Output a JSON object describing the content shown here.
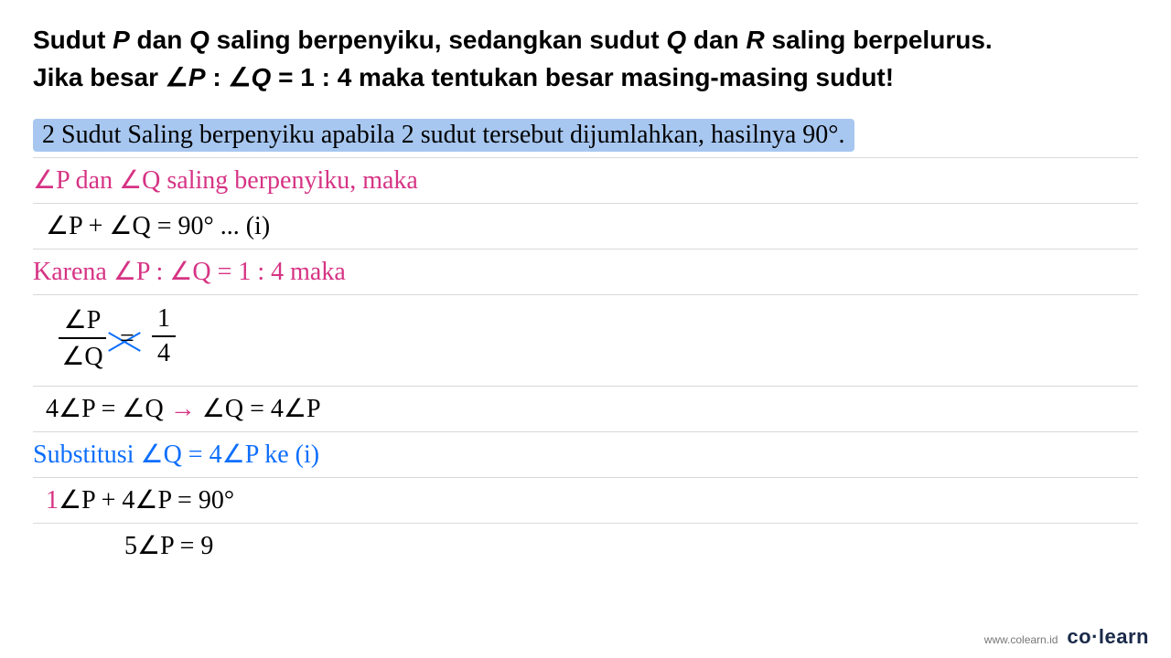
{
  "problem": {
    "line1_a": "Sudut ",
    "line1_P": "P",
    "line1_b": " dan ",
    "line1_Q": "Q",
    "line1_c": " saling berpenyiku, sedangkan sudut ",
    "line1_Q2": "Q",
    "line1_d": " dan ",
    "line1_R": "R",
    "line1_e": " saling berpelurus.",
    "line2_a": "Jika besar ∠",
    "line2_P": "P",
    "line2_b": " : ∠",
    "line2_Q": "Q",
    "line2_c": " = 1 : 4 maka tentukan besar masing-masing sudut!"
  },
  "work": {
    "line1": "2 Sudut Saling berpenyiku apabila 2 sudut tersebut dijumlahkan, hasilnya 90°.",
    "line2": "∠P dan ∠Q saling berpenyiku, maka",
    "line3": "∠P + ∠Q = 90° ... (i)",
    "line4": "Karena ∠P : ∠Q = 1 : 4 maka",
    "frac": {
      "top1": "∠P",
      "bot1": "∠Q",
      "top2": "1",
      "bot2": "4"
    },
    "line6a": "4∠P = ∠Q ",
    "line6arrow": "→",
    "line6b": " ∠Q = 4∠P",
    "line7": "Substitusi ∠Q = 4∠P ke (i)",
    "line8a": "1",
    "line8b": "∠P + 4∠P = 90°",
    "line9": "5∠P = 9"
  },
  "footer": {
    "url": "www.colearn.id",
    "brand": "co·learn"
  }
}
